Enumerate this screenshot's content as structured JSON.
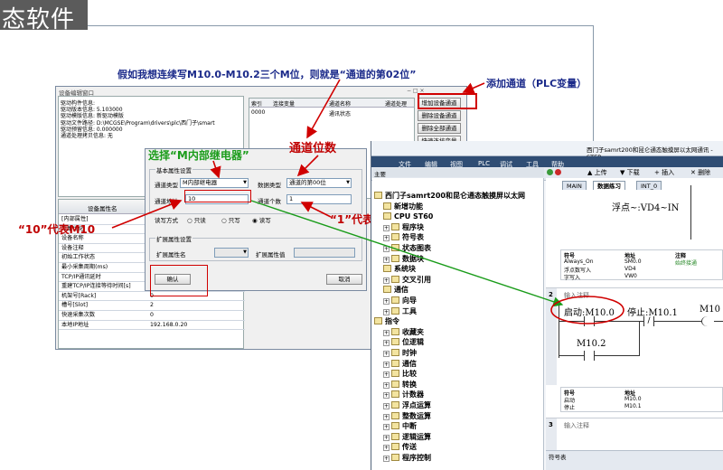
{
  "header": {
    "title_fragment": "态软件"
  },
  "annotations": {
    "question": "假如我想连续写M10.0-M10.2三个M位，则就是“通道的第02位”",
    "add_channel": "添加通道（PLC变量）",
    "channel_bit": "通道位数",
    "select_m": "选择“M内部继电器”",
    "ten_means": "“10”代表M10",
    "one_means": "“1”代表0位 也就是0.0位"
  },
  "device_window": {
    "title": "设备编辑窗口",
    "info_lines": [
      "驱动构件信息:",
      "驱动版本信息: 5.103000",
      "驱动模版信息: 新驱动模版",
      "驱动文件路径: D:\\MCGSE\\Program\\drivers\\plc\\西门子\\smart",
      "驱动预留信息: 0.000000",
      "通道处理拷贝信息: 无"
    ],
    "prop_header": "设备属性名",
    "props": [
      {
        "k": "[内部属性]",
        "v": ""
      },
      {
        "k": "采集优化",
        "v": ""
      },
      {
        "k": "设备名称",
        "v": ""
      },
      {
        "k": "设备注释",
        "v": ""
      },
      {
        "k": "初始工作状态",
        "v": ""
      },
      {
        "k": "最小采集周期(ms)",
        "v": ""
      },
      {
        "k": "TCP/IP通讯延时",
        "v": ""
      },
      {
        "k": "重建TCP/IP连接等待时间[s]",
        "v": "10"
      },
      {
        "k": "机架号[Rack]",
        "v": "0"
      },
      {
        "k": "槽号[Slot]",
        "v": "2"
      },
      {
        "k": "快速采集次数",
        "v": "0"
      },
      {
        "k": "本地IP地址",
        "v": "192.168.0.20"
      }
    ],
    "channel_headers": [
      "索引",
      "连接变量",
      "通道名称",
      "通道处理"
    ],
    "channel_rows": [
      {
        "idx": "0000",
        "var": "",
        "name": "通讯状态",
        "proc": ""
      }
    ],
    "side_buttons": [
      "增加设备通道",
      "删除设备通道",
      "删除全部通道",
      "快速连接变量"
    ]
  },
  "add_channel_dialog": {
    "basic_group": "基本属性设置",
    "channel_type_label": "通道类型",
    "channel_type_value": "M内部继电器",
    "data_type_label": "数据类型",
    "data_type_value": "通道的第00位",
    "address_label": "通道地址",
    "address_value": "10",
    "count_label": "通道个数",
    "count_value": "1",
    "rw_label": "读写方式",
    "rw_options": [
      "只读",
      "只写",
      "读写"
    ],
    "ext_group": "扩展属性设置",
    "ext_name_label": "扩展属性名",
    "ext_value_label": "扩展属性值",
    "confirm": "确认",
    "cancel": "取消"
  },
  "step7": {
    "title": "西门子samrt200和昆仑通态触摸屏以太网通讯 - STEP",
    "menu": [
      "文件",
      "编辑",
      "视图",
      "PLC",
      "调试",
      "工具",
      "帮助"
    ],
    "toolbar": {
      "upload": "上传",
      "download": "下载",
      "insert": "插入",
      "delete": "删除"
    },
    "main_tab": "主要",
    "tree": [
      {
        "label": "西门子samrt200和昆仑通态触摸屏以太网",
        "type": "folder"
      },
      {
        "label": "新增功能",
        "type": "item"
      },
      {
        "label": "CPU ST60",
        "type": "item"
      },
      {
        "label": "程序块",
        "type": "plus"
      },
      {
        "label": "符号表",
        "type": "plus"
      },
      {
        "label": "状态图表",
        "type": "plus"
      },
      {
        "label": "数据块",
        "type": "plus"
      },
      {
        "label": "系统块",
        "type": "item"
      },
      {
        "label": "交叉引用",
        "type": "plus"
      },
      {
        "label": "通信",
        "type": "item"
      },
      {
        "label": "向导",
        "type": "plus"
      },
      {
        "label": "工具",
        "type": "plus"
      },
      {
        "label": "指令",
        "type": "folder"
      },
      {
        "label": "收藏夹",
        "type": "plus"
      },
      {
        "label": "位逻辑",
        "type": "plus"
      },
      {
        "label": "时钟",
        "type": "plus"
      },
      {
        "label": "通信",
        "type": "plus"
      },
      {
        "label": "比较",
        "type": "plus"
      },
      {
        "label": "转换",
        "type": "plus"
      },
      {
        "label": "计数器",
        "type": "plus"
      },
      {
        "label": "浮点运算",
        "type": "plus"
      },
      {
        "label": "整数运算",
        "type": "plus"
      },
      {
        "label": "中断",
        "type": "plus"
      },
      {
        "label": "逻辑运算",
        "type": "plus"
      },
      {
        "label": "传送",
        "type": "plus"
      },
      {
        "label": "程序控制",
        "type": "plus"
      }
    ],
    "editor_tabs": [
      "MAIN",
      "数据练习",
      "INT_0"
    ],
    "float_label": "浮点~:VD4~IN",
    "sym_table1": {
      "headers": [
        "符号",
        "地址",
        "注释"
      ],
      "rows": [
        [
          "Always_On",
          "SM0.0",
          "始终接通"
        ],
        [
          "浮点数写入",
          "VD4",
          ""
        ],
        [
          "字写入",
          "VW0",
          ""
        ]
      ]
    },
    "network2": {
      "num": "2",
      "comment": "输入注释",
      "start": "启动:M10.0",
      "stop": "停止:M10.1",
      "coil": "M10",
      "hold": "M10.2"
    },
    "sym_table2": {
      "headers": [
        "符号",
        "地址"
      ],
      "rows": [
        [
          "启动",
          "M10.0"
        ],
        [
          "停止",
          "M10.1"
        ]
      ]
    },
    "network3": {
      "num": "3",
      "comment": "输入注释"
    },
    "bottom_panel": "符号表"
  }
}
